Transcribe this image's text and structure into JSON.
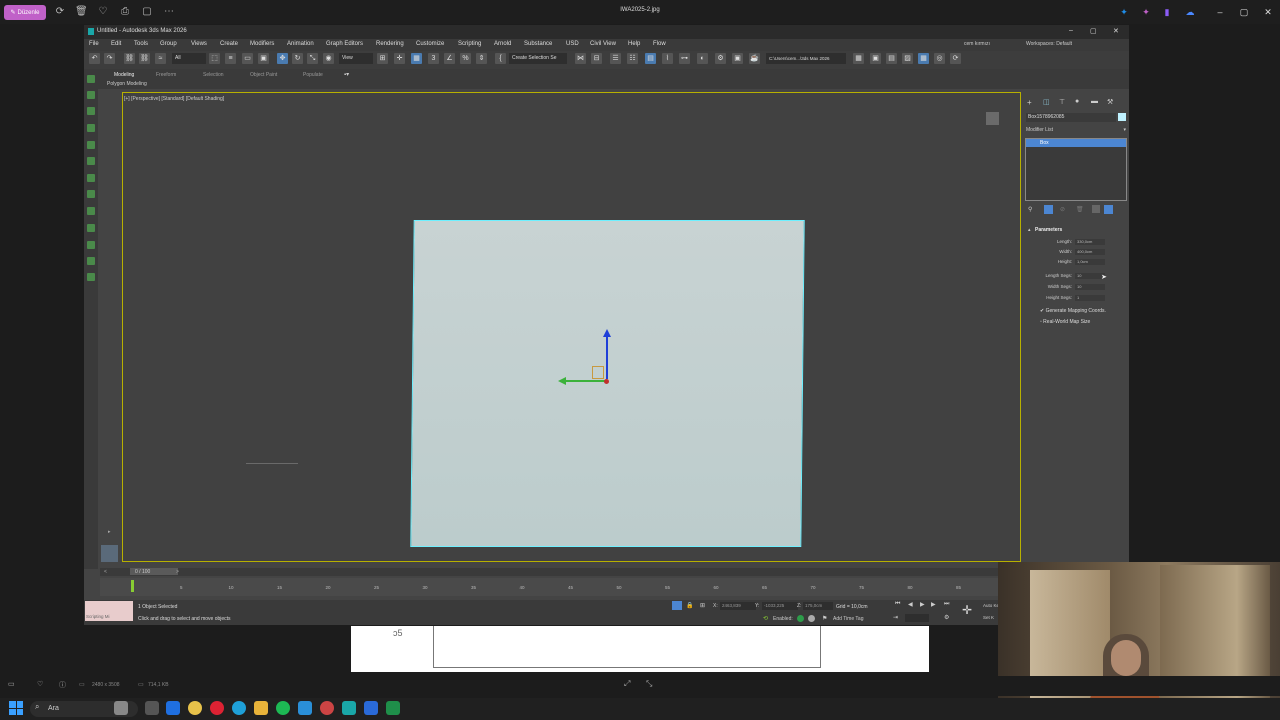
{
  "viewer": {
    "edit_label": "Düzenle",
    "title": "IWA2025-2.jpg",
    "image_size": "2480 x 3508",
    "file_size": "714,1 KB"
  },
  "app": {
    "title": "Untitled - Autodesk 3ds Max 2026",
    "menus": [
      "File",
      "Edit",
      "Tools",
      "Group",
      "Views",
      "Create",
      "Modifiers",
      "Animation",
      "Graph Editors",
      "Rendering",
      "Customize",
      "Scripting",
      "Arnold",
      "Substance",
      "USD",
      "Civil View",
      "Help",
      "Flow"
    ],
    "user": "cem kırmızı",
    "workspace_label": "Workspaces: Default",
    "selection_set": "Create Selection Se",
    "project_path": "C:\\Users\\cem...\\3ds Max 2026",
    "view_dropdown": "View",
    "all_filter": "All"
  },
  "ribbon": {
    "tabs": [
      "Modeling",
      "Freeform",
      "Selection",
      "Object Paint",
      "Populate"
    ],
    "sub_label": "Polygon Modeling"
  },
  "viewport": {
    "label": "[+] [Perspective] [Standard] [Default Shading]"
  },
  "command_panel": {
    "object_name": "Box1578962085",
    "modifier_list": "Modifier List",
    "stack_item": "Box",
    "params_title": "Parameters",
    "params": [
      {
        "label": "Length:",
        "value": "330,0cm"
      },
      {
        "label": "Width:",
        "value": "400,0cm"
      },
      {
        "label": "Height:",
        "value": "1,0cm"
      },
      {
        "label": "Length Segs:",
        "value": "10"
      },
      {
        "label": "Width Segs:",
        "value": "10"
      },
      {
        "label": "Height Segs:",
        "value": "1"
      }
    ],
    "checks": [
      "Generate Mapping Coords.",
      "Real-World Map Size"
    ]
  },
  "timeline": {
    "frame": "0 / 100",
    "ticks": [
      "5",
      "10",
      "15",
      "20",
      "25",
      "30",
      "35",
      "40",
      "45",
      "50",
      "55",
      "60",
      "65",
      "70",
      "75",
      "80",
      "85",
      "90",
      "95"
    ]
  },
  "status": {
    "maxscript": "Scripting Mi",
    "selected": "1 Object Selected",
    "hint": "Click and drag to select and move objects",
    "x": "2463,839",
    "y": "-1033,225",
    "z": "175,0cm",
    "grid": "Grid = 10,0cm",
    "enabled": "Enabled:",
    "add_time_tag": "Add Time Tag",
    "auto_key": "Auto Key",
    "set_key": "Set K"
  },
  "taskbar": {
    "search": "Ara"
  },
  "colors": {
    "accent": "#c061c8",
    "selection_blue": "#4c86d2",
    "object_color": "#bff2ff",
    "plane_outline": "#6ef0ff",
    "viewport_border": "#b7b000"
  }
}
